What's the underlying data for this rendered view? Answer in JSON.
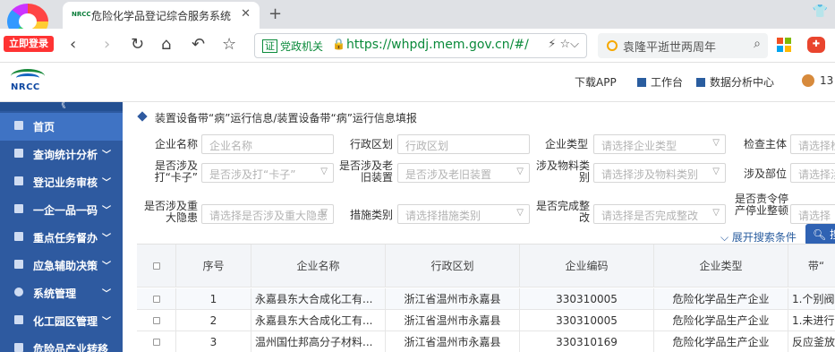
{
  "browser": {
    "login_badge": "立即登录",
    "tab": {
      "favicon_text": "NRCC",
      "title": "危险化学品登记综合服务系统",
      "close": "✕"
    },
    "new_tab": "+",
    "url": {
      "cert_mark": "证",
      "label": "党政机关",
      "text": "https://whpdj.mem.gov.cn/#/"
    },
    "search": {
      "text": "袁隆平逝世两周年"
    }
  },
  "app": {
    "logo_text": "NRCC",
    "header_links": [
      "下载APP",
      "工作台",
      "数据分析中心"
    ],
    "user_partial": "13",
    "colors": {
      "sidebar": "#2e5aa0",
      "sidebar_active": "#3f73c4",
      "accent": "#2f62b3"
    }
  },
  "sidebar": {
    "collapse_label": "《",
    "items": [
      {
        "label": "首页",
        "icon": "chart-icon",
        "has_children": false,
        "active": true
      },
      {
        "label": "查询统计分析",
        "icon": "bar-chart-icon",
        "has_children": true
      },
      {
        "label": "登记业务审核",
        "icon": "document-icon",
        "has_children": true
      },
      {
        "label": "一企一品一码",
        "icon": "grid-icon",
        "has_children": true
      },
      {
        "label": "重点任务督办",
        "icon": "task-icon",
        "has_children": true
      },
      {
        "label": "应急辅助决策",
        "icon": "emergency-icon",
        "has_children": true
      },
      {
        "label": "系统管理",
        "icon": "gear-icon",
        "has_children": true
      },
      {
        "label": "化工园区管理",
        "icon": "factory-icon",
        "has_children": true
      },
      {
        "label": "危险品产业转移",
        "icon": "transfer-icon",
        "has_children": true
      }
    ]
  },
  "breadcrumb": "装置设备带“病”运行信息/装置设备带“病”运行信息填报",
  "filters": [
    {
      "label": "企业名称",
      "placeholder": "企业名称",
      "dropdown": false
    },
    {
      "label": "行政区划",
      "placeholder": "行政区划",
      "dropdown": false
    },
    {
      "label": "企业类型",
      "placeholder": "请选择企业类型",
      "dropdown": true
    },
    {
      "label": "检查主体",
      "placeholder": "请选择检",
      "dropdown": false
    },
    {
      "label": "是否涉及打“卡子”",
      "placeholder": "是否涉及打“卡子”",
      "dropdown": true
    },
    {
      "label": "是否涉及老旧装置",
      "placeholder": "是否涉及老旧装置",
      "dropdown": true
    },
    {
      "label": "涉及物料类别",
      "placeholder": "请选择涉及物料类别",
      "dropdown": true
    },
    {
      "label": "涉及部位",
      "placeholder": "请选择涉",
      "dropdown": false
    },
    {
      "label": "是否涉及重大隐患",
      "placeholder": "请选择是否涉及重大隐患",
      "dropdown": true
    },
    {
      "label": "措施类别",
      "placeholder": "请选择措施类别",
      "dropdown": true
    },
    {
      "label": "是否完成整改",
      "placeholder": "请选择是否完成整改",
      "dropdown": true
    },
    {
      "label": "是否责令停产停业整顿",
      "placeholder": "请选择",
      "dropdown": false
    }
  ],
  "expand_label": "展开搜索条件",
  "search_button": "搜",
  "table": {
    "columns": [
      "序号",
      "企业名称",
      "行政区划",
      "企业编码",
      "企业类型",
      "带“"
    ],
    "rows": [
      {
        "no": "1",
        "name": "永嘉县东大合成化工有...",
        "region": "浙江省温州市永嘉县",
        "code": "330310005",
        "type": "危险化学品生产企业",
        "extra": "1.个别阀"
      },
      {
        "no": "2",
        "name": "永嘉县东大合成化工有...",
        "region": "浙江省温州市永嘉县",
        "code": "330310005",
        "type": "危险化学品生产企业",
        "extra": "1.未进行"
      },
      {
        "no": "3",
        "name": "温州国仕邦高分子材料...",
        "region": "浙江省温州市永嘉县",
        "code": "330310169",
        "type": "危险化学品生产企业",
        "extra": "反应釜放"
      }
    ]
  }
}
